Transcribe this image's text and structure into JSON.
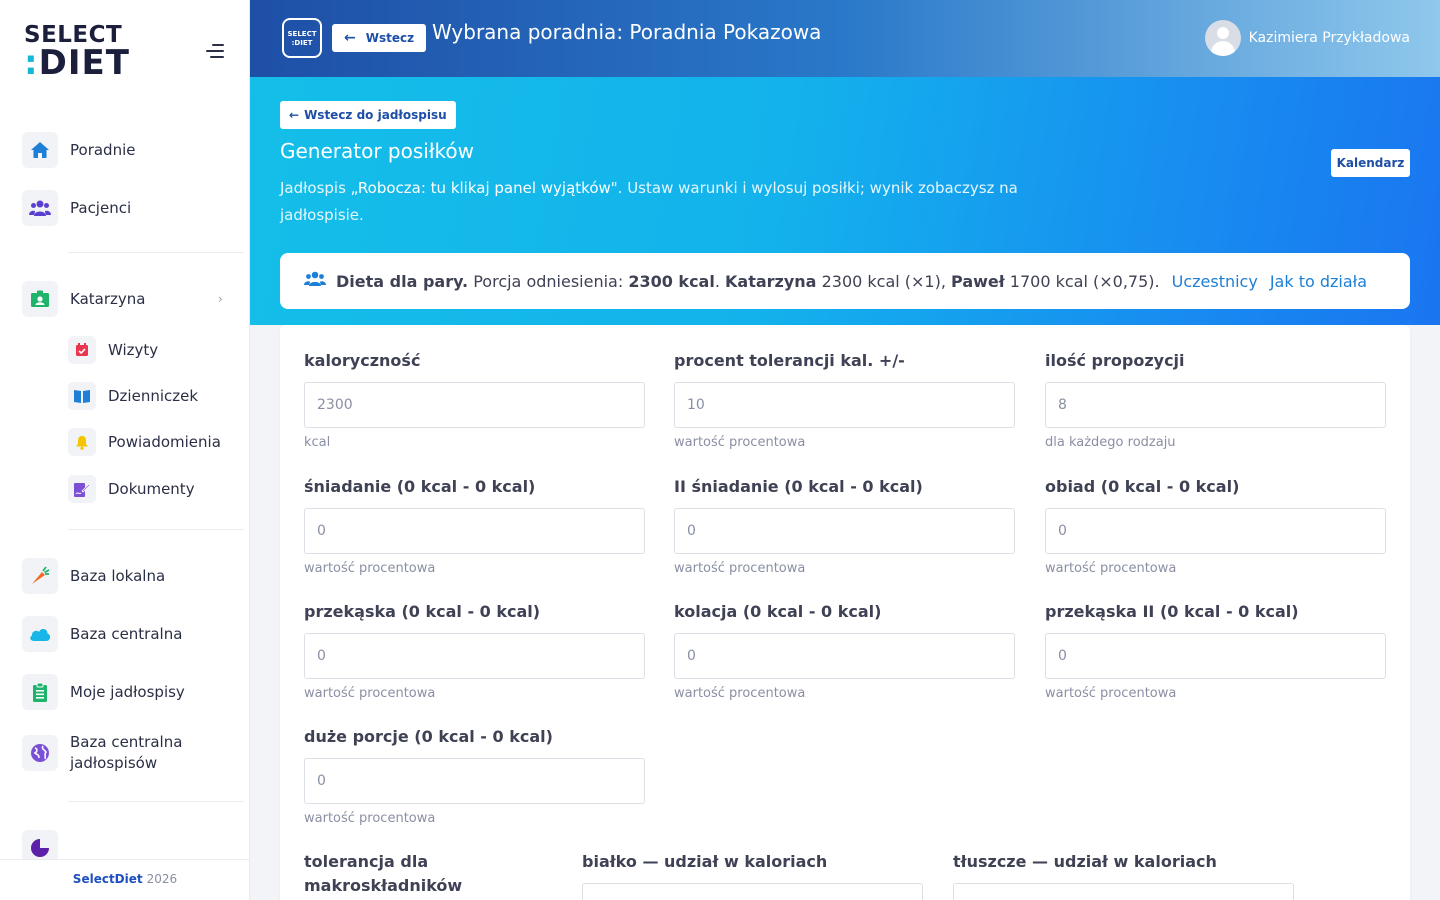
{
  "sidebar": {
    "logo_top": "SELECT",
    "logo_bottom_dots": ":",
    "logo_bottom": "DIET",
    "items": [
      {
        "label": "Poradnie",
        "icon": "home-icon",
        "color": "#1e7fd6"
      },
      {
        "label": "Pacjenci",
        "icon": "users-icon",
        "color": "#5b3fd1"
      },
      {
        "label": "Katarzyna",
        "icon": "id-card-icon",
        "color": "#20b36b"
      },
      {
        "label": "Baza lokalna",
        "icon": "carrot-icon",
        "color": "#f06a2a"
      },
      {
        "label": "Baza centralna",
        "icon": "cloud-icon",
        "color": "#18b6e6"
      },
      {
        "label": "Moje jadłospisy",
        "icon": "clipboard-list-icon",
        "color": "#20b36b"
      },
      {
        "label": "Baza centralna jadłospisów",
        "icon": "globe-icon",
        "color": "#7b4fd6"
      }
    ],
    "sub_items": [
      {
        "label": "Wizyty",
        "icon": "calendar-check-icon",
        "color": "#e8364f"
      },
      {
        "label": "Dzienniczek",
        "icon": "book-icon",
        "color": "#1e7fd6"
      },
      {
        "label": "Powiadomienia",
        "icon": "bell-icon",
        "color": "#f5c400"
      },
      {
        "label": "Dokumenty",
        "icon": "file-signature-icon",
        "color": "#7b4fd6"
      }
    ],
    "footer_brand": "SelectDiet",
    "footer_year": "2026"
  },
  "topbar": {
    "mini_logo_top": "SELECT",
    "mini_logo_bottom": ":DIET",
    "back_label": "Wstecz",
    "title": "Wybrana poradnia: Poradnia Pokazowa",
    "user_name": "Kazimiera Przykładowa"
  },
  "header": {
    "back_to_menu": "Wstecz do jadłospisu",
    "title": "Generator posiłków",
    "desc_prefix": "Jadłospis ",
    "desc_menu": "„Robocza: tu klikaj panel wyjątków\"",
    "desc_suffix": ". Ustaw warunki i wylosuj posiłki; wynik zobaczysz na jadłospisie.",
    "calendar_label": "Kalendarz"
  },
  "diet": {
    "title": "Dieta dla pary.",
    "portion_label": "Porcja odniesienia:",
    "portion_value": "2300 kcal",
    "person1_name": "Katarzyna",
    "person1_value": "2300 kcal (×1),",
    "person2_name": "Paweł",
    "person2_value": "1700 kcal (×0,75).",
    "link_participants": "Uczestnicy",
    "link_how": "Jak to działa"
  },
  "form": {
    "fields": [
      {
        "label": "kaloryczność",
        "value": "2300",
        "hint": "kcal"
      },
      {
        "label": "procent tolerancji kal. +/-",
        "value": "10",
        "hint": "wartość procentowa"
      },
      {
        "label": "ilość propozycji",
        "value": "8",
        "hint": "dla każdego rodzaju"
      },
      {
        "label": "śniadanie (0 kcal - 0 kcal)",
        "value": "0",
        "hint": "wartość procentowa"
      },
      {
        "label": "II śniadanie (0 kcal - 0 kcal)",
        "value": "0",
        "hint": "wartość procentowa"
      },
      {
        "label": "obiad (0 kcal - 0 kcal)",
        "value": "0",
        "hint": "wartość procentowa"
      },
      {
        "label": "przekąska (0 kcal - 0 kcal)",
        "value": "0",
        "hint": "wartość procentowa"
      },
      {
        "label": "kolacja (0 kcal - 0 kcal)",
        "value": "0",
        "hint": "wartość procentowa"
      },
      {
        "label": "przekąska II (0 kcal - 0 kcal)",
        "value": "0",
        "hint": "wartość procentowa"
      },
      {
        "label": "duże porcje (0 kcal - 0 kcal)",
        "value": "0",
        "hint": "wartość procentowa"
      }
    ],
    "macro_tolerance_label": "tolerancja dla makroskładników",
    "protein_label": "białko — udział w kaloriach",
    "fat_label": "tłuszcze — udział w kaloriach"
  },
  "colors": {
    "accent": "#1e4fa6",
    "link": "#1e7fd6",
    "header_gradient_start": "#14bfe8",
    "header_gradient_end": "#1a75f0"
  }
}
